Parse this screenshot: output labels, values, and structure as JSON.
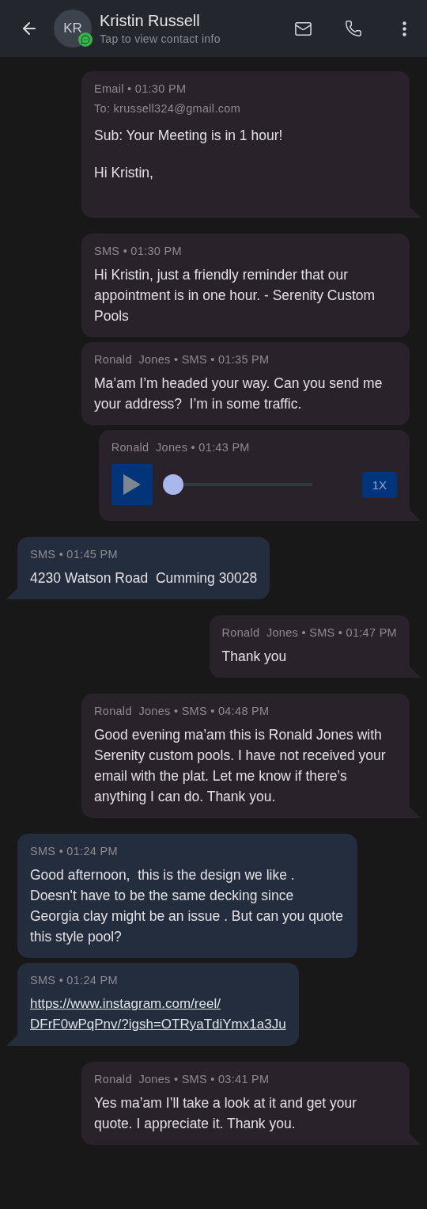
{
  "header": {
    "avatar_initials": "KR",
    "name": "Kristin Russell",
    "subtitle": "Tap to view contact info"
  },
  "messages": [
    {
      "kind": "email",
      "incoming": false,
      "tail": true,
      "meta": "Email • 01:30 PM",
      "to": "To: krussell324@gmail.com",
      "subject": "Sub: Your Meeting is in 1 hour!",
      "body": "Hi Kristin,"
    },
    {
      "kind": "text",
      "incoming": false,
      "tail": false,
      "meta": "SMS • 01:30 PM",
      "body": "Hi Kristin, just a friendly reminder that our appointment is in one hour. - Serenity Custom Pools"
    },
    {
      "kind": "text",
      "incoming": false,
      "tail": false,
      "meta": "Ronald  Jones • SMS • 01:35 PM",
      "body": "Ma’am I’m headed your way. Can you send me your address?  I’m in some traffic."
    },
    {
      "kind": "audio",
      "incoming": false,
      "tail": true,
      "meta": "Ronald  Jones • 01:43 PM",
      "level": 0,
      "speed": "1X"
    },
    {
      "kind": "text",
      "incoming": true,
      "tail": true,
      "meta": "SMS • 01:45 PM",
      "body": "4230 Watson Road  Cumming 30028"
    },
    {
      "kind": "text",
      "incoming": false,
      "tail": true,
      "meta": "Ronald  Jones • SMS • 01:47 PM",
      "body": "Thank you"
    },
    {
      "kind": "text",
      "incoming": false,
      "tail": true,
      "meta": "Ronald  Jones • SMS • 04:48 PM",
      "body": "Good evening ma’am this is Ronald Jones with Serenity custom pools. I have not received your email with the plat. Let me know if there’s anything I can do. Thank you."
    },
    {
      "kind": "text",
      "incoming": true,
      "tail": false,
      "meta": "SMS • 01:24 PM",
      "body": "Good afternoon,  this is the design we like . Doesn't have to be the same decking since Georgia clay might be an issue . But can you quote this style pool?"
    },
    {
      "kind": "link",
      "incoming": true,
      "tail": true,
      "meta": "SMS • 01:24 PM",
      "body": "https://www.instagram.com/reel/ DFrF0wPqPnv/?igsh=OTRyaTdiYmx1a3Ju"
    },
    {
      "kind": "text",
      "incoming": false,
      "tail": true,
      "meta": "Ronald  Jones • SMS • 03:41 PM",
      "body": "Yes ma’am I’ll take a look at it and get your quote. I appreciate it. Thank you."
    }
  ]
}
